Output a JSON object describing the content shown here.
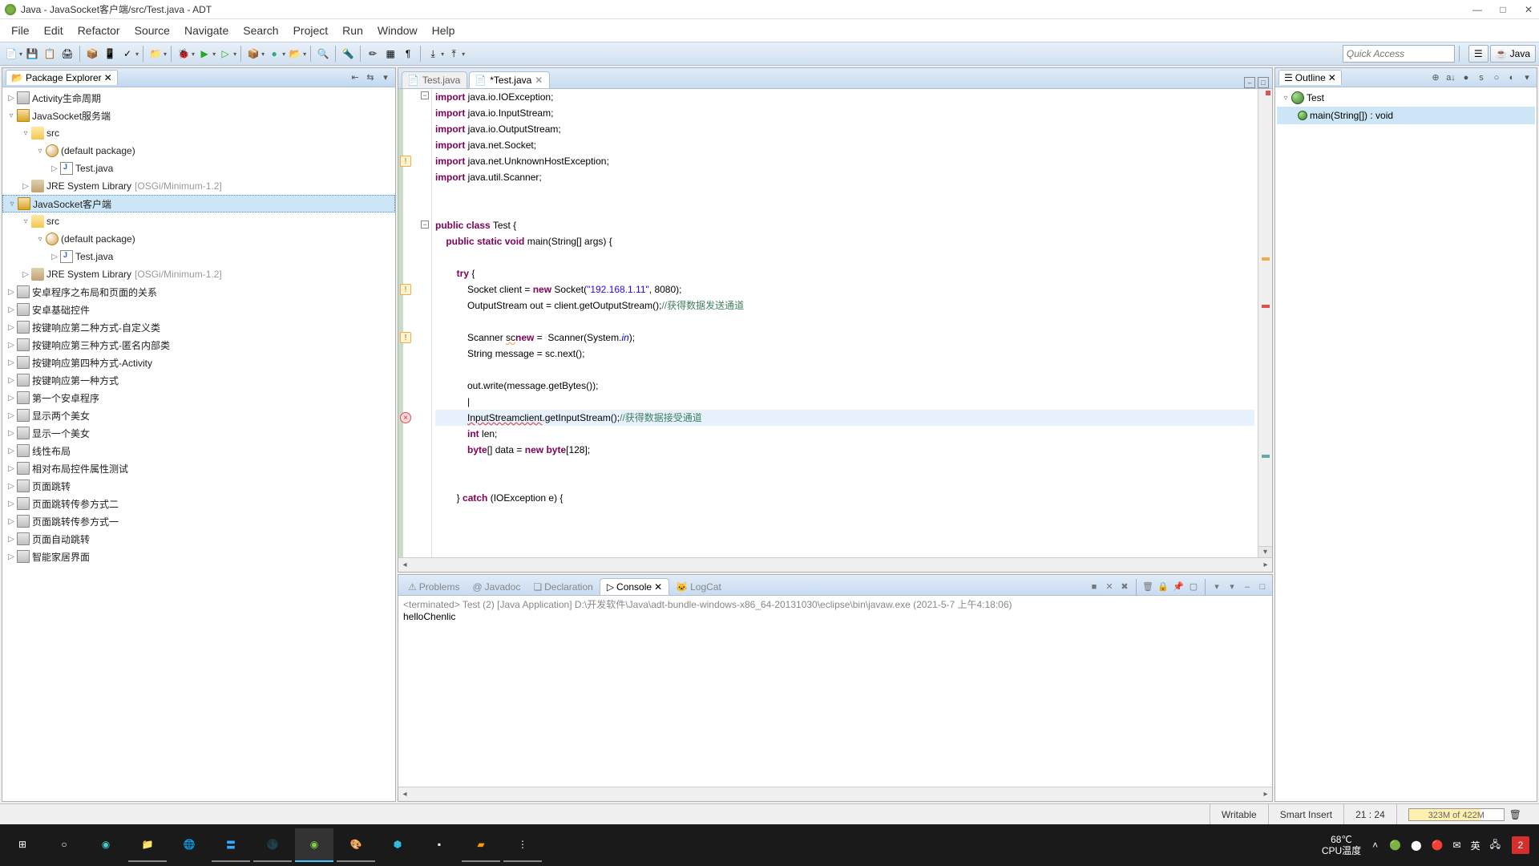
{
  "window": {
    "title": "Java - JavaSocket客户端/src/Test.java - ADT"
  },
  "menu": [
    "File",
    "Edit",
    "Refactor",
    "Source",
    "Navigate",
    "Search",
    "Project",
    "Run",
    "Window",
    "Help"
  ],
  "quick_access_placeholder": "Quick Access",
  "perspective": {
    "java": "Java"
  },
  "package_explorer": {
    "title": "Package Explorer",
    "nodes": [
      {
        "d": 1,
        "exp": "▷",
        "icon": "proj-closed",
        "label": "Activity生命周期"
      },
      {
        "d": 1,
        "exp": "▿",
        "icon": "proj",
        "label": "JavaSocket服务端"
      },
      {
        "d": 2,
        "exp": "▿",
        "icon": "folder",
        "label": "src"
      },
      {
        "d": 3,
        "exp": "▿",
        "icon": "pkg",
        "label": "(default package)"
      },
      {
        "d": 4,
        "exp": "▷",
        "icon": "java",
        "label": "Test.java"
      },
      {
        "d": 2,
        "exp": "▷",
        "icon": "lib",
        "label": "JRE System Library",
        "extra": "[OSGi/Minimum-1.2]"
      },
      {
        "d": 1,
        "exp": "▿",
        "icon": "proj",
        "label": "JavaSocket客户端",
        "sel": true
      },
      {
        "d": 2,
        "exp": "▿",
        "icon": "folder",
        "label": "src"
      },
      {
        "d": 3,
        "exp": "▿",
        "icon": "pkg",
        "label": "(default package)"
      },
      {
        "d": 4,
        "exp": "▷",
        "icon": "java",
        "label": "Test.java"
      },
      {
        "d": 2,
        "exp": "▷",
        "icon": "lib",
        "label": "JRE System Library",
        "extra": "[OSGi/Minimum-1.2]"
      },
      {
        "d": 1,
        "exp": "▷",
        "icon": "proj-closed",
        "label": "安卓程序之布局和页面的关系"
      },
      {
        "d": 1,
        "exp": "▷",
        "icon": "proj-closed",
        "label": "安卓基础控件"
      },
      {
        "d": 1,
        "exp": "▷",
        "icon": "proj-closed",
        "label": "按键响应第二种方式-自定义类"
      },
      {
        "d": 1,
        "exp": "▷",
        "icon": "proj-closed",
        "label": "按键响应第三种方式-匿名内部类"
      },
      {
        "d": 1,
        "exp": "▷",
        "icon": "proj-closed",
        "label": "按键响应第四种方式-Activity"
      },
      {
        "d": 1,
        "exp": "▷",
        "icon": "proj-closed",
        "label": "按键响应第一种方式"
      },
      {
        "d": 1,
        "exp": "▷",
        "icon": "proj-closed",
        "label": "第一个安卓程序"
      },
      {
        "d": 1,
        "exp": "▷",
        "icon": "proj-closed",
        "label": "显示两个美女"
      },
      {
        "d": 1,
        "exp": "▷",
        "icon": "proj-closed",
        "label": "显示一个美女"
      },
      {
        "d": 1,
        "exp": "▷",
        "icon": "proj-closed",
        "label": "线性布局"
      },
      {
        "d": 1,
        "exp": "▷",
        "icon": "proj-closed",
        "label": "相对布局控件属性测试"
      },
      {
        "d": 1,
        "exp": "▷",
        "icon": "proj-closed",
        "label": "页面跳转"
      },
      {
        "d": 1,
        "exp": "▷",
        "icon": "proj-closed",
        "label": "页面跳转传参方式二"
      },
      {
        "d": 1,
        "exp": "▷",
        "icon": "proj-closed",
        "label": "页面跳转传参方式一"
      },
      {
        "d": 1,
        "exp": "▷",
        "icon": "proj-closed",
        "label": "页面自动跳转"
      },
      {
        "d": 1,
        "exp": "▷",
        "icon": "proj-closed",
        "label": "智能家居界面"
      }
    ]
  },
  "editor": {
    "tabs": [
      {
        "label": "Test.java",
        "dirty": false,
        "active": false
      },
      {
        "label": "*Test.java",
        "dirty": true,
        "active": true
      }
    ],
    "code_lines": [
      {
        "t": "import",
        "rest": " java.io.IOException;"
      },
      {
        "t": "import",
        "rest": " java.io.InputStream;"
      },
      {
        "t": "import",
        "rest": " java.io.OutputStream;"
      },
      {
        "t": "import",
        "rest": " java.net.Socket;"
      },
      {
        "t": "import",
        "rest": " java.net.UnknownHostException;",
        "warn": true
      },
      {
        "t": "import",
        "rest": " java.util.Scanner;"
      },
      {
        "t": "",
        "rest": ""
      },
      {
        "t": "",
        "rest": ""
      },
      {
        "pre": "",
        "kw": "public class",
        "rest": " Test {"
      },
      {
        "pre": "    ",
        "kw": "public static void",
        "rest": " main(String[] args) {"
      },
      {
        "pre": "",
        "rest": ""
      },
      {
        "pre": "        ",
        "kw": "try",
        "rest": " {"
      },
      {
        "pre": "            ",
        "rest": "Socket client = ",
        "kw2": "new",
        "rest2": " Socket(",
        "str": "\"192.168.1.11\"",
        "rest3": ", 8080);",
        "warn": true
      },
      {
        "pre": "            ",
        "rest": "OutputStream out = client.getOutputStream();",
        "cmt": "//获得数据发送通道"
      },
      {
        "pre": "",
        "rest": ""
      },
      {
        "pre": "            ",
        "rest": "Scanner ",
        "warnspan": "sc",
        "rest2": " = ",
        "kw2": "new",
        "rest3": " Scanner(System.",
        "it": "in",
        "rest4": ");",
        "warn": true
      },
      {
        "pre": "            ",
        "rest": "String message = sc.next();"
      },
      {
        "pre": "",
        "rest": ""
      },
      {
        "pre": "            ",
        "rest": "out.write(message.getBytes());"
      },
      {
        "pre": "            ",
        "rest": "|",
        "cursor": true
      },
      {
        "pre": "            ",
        "errspan": "InputStreamclient",
        "rest": ".getInputStream();",
        "cmt": "//获得数据接受通道",
        "hl": true,
        "err": true
      },
      {
        "pre": "            ",
        "kw": "int",
        "rest": " len;"
      },
      {
        "pre": "            ",
        "kw": "byte",
        "rest": "[] data = ",
        "kw2": "new",
        "rest2": " ",
        "kw3": "byte",
        "rest3": "[128];"
      },
      {
        "pre": "",
        "rest": ""
      },
      {
        "pre": "",
        "rest": ""
      },
      {
        "pre": "        ",
        "rest": "} ",
        "kw2": "catch",
        "rest2": " (IOException e) {"
      }
    ]
  },
  "overview_marks": [
    {
      "top": "2%",
      "color": "#d9534f",
      "type": "sq"
    },
    {
      "top": "36%",
      "color": "#f0ad4e"
    },
    {
      "top": "46%",
      "color": "#d9534f"
    },
    {
      "top": "78%",
      "color": "#3a87ad"
    }
  ],
  "outline": {
    "title": "Outline",
    "root": {
      "label": "Test",
      "icon": "class"
    },
    "method": {
      "label": "main(String[]) : void",
      "icon": "method"
    }
  },
  "bottom": {
    "tabs": [
      "Problems",
      "Javadoc",
      "Declaration",
      "Console",
      "LogCat"
    ],
    "active": 3,
    "terminated_line": "<terminated> Test (2) [Java Application] D:\\开发软件\\Java\\adt-bundle-windows-x86_64-20131030\\eclipse\\bin\\javaw.exe (2021-5-7 上午4:18:06)",
    "output": "helloChenlic"
  },
  "status": {
    "writable": "Writable",
    "insert": "Smart Insert",
    "pos": "21 : 24",
    "heap": "323M of 422M"
  },
  "tray": {
    "temp1": "68℃",
    "temp2": "CPU温度"
  }
}
